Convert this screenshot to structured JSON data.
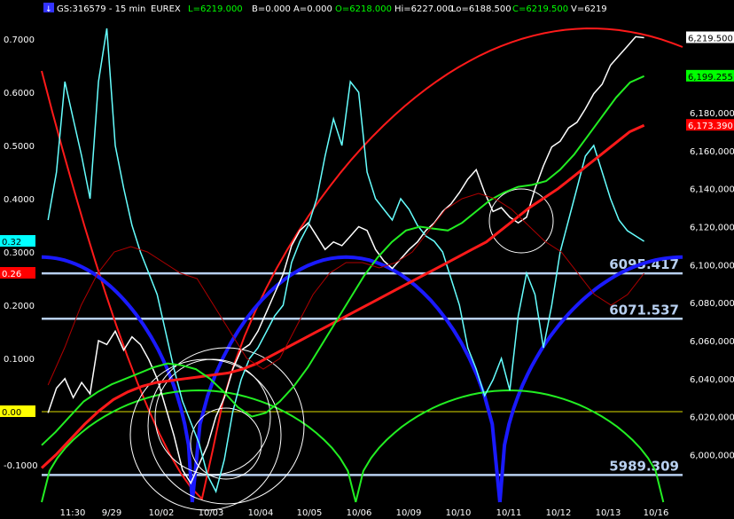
{
  "header": {
    "icon_glyph": "↓",
    "symbol": "GS:316579 - 15 min",
    "exchange": "EUREX",
    "last": "L=6219.000",
    "bid": "B=0.000",
    "ask": "A=0.000",
    "open": "O=6218.000",
    "high": "Hi=6227.000",
    "low": "Lo=6188.500",
    "close": "C=6219.500",
    "volume": "V=6219"
  },
  "colors": {
    "background": "#000000",
    "text": "#ffffff",
    "last_text": "#00ff00",
    "price": "#ffffff",
    "oscillator": "#66ffff",
    "red_line": "#ff1a1a",
    "green_line": "#22ee22",
    "dark_red_line": "#b00000",
    "blue_arcs": "#1a1aff",
    "level_lines": "#b8d0f0",
    "zero_line": "#dddd00",
    "axis_text": "#ffffff"
  },
  "chart_data": {
    "type": "line",
    "left_axis": {
      "ticks": [
        "0.7000",
        "0.6000",
        "0.5000",
        "0.4000",
        "0.3000",
        "0.2000",
        "0.1000",
        "0.00",
        "-0.1000"
      ],
      "ylim": [
        -0.17,
        0.74
      ]
    },
    "right_axis": {
      "ticks": [
        "6,220,000",
        "6,180,000",
        "6,160,000",
        "6,140,000",
        "6,120,000",
        "6,100,000",
        "6,080,000",
        "6,060,000",
        "6,040,000",
        "6,020,000",
        "6,000,000"
      ],
      "ylim": [
        5975,
        6230
      ]
    },
    "x_ticks": [
      "11:30",
      "9/29",
      "10/02",
      "10/03",
      "10/04",
      "10/05",
      "10/06",
      "10/09",
      "10/10",
      "10/11",
      "10/12",
      "10/13",
      "10/16"
    ],
    "markers": [
      {
        "label": "0.32",
        "axis": "left",
        "value": 0.32,
        "bg": "#00ffff",
        "fg": "#000000"
      },
      {
        "label": "0.26",
        "axis": "left",
        "value": 0.26,
        "bg": "#ff0000",
        "fg": "#ffffff"
      },
      {
        "label": "0.00",
        "axis": "left",
        "value": 0.0,
        "bg": "#ffff00",
        "fg": "#000000"
      },
      {
        "label": "6,219.500",
        "axis": "right",
        "value": 6219.5,
        "bg": "#ffffff",
        "fg": "#000000"
      },
      {
        "label": "6,199.255",
        "axis": "right",
        "value": 6199.255,
        "bg": "#00ff00",
        "fg": "#000000"
      },
      {
        "label": "6,173.390",
        "axis": "right",
        "value": 6173.39,
        "bg": "#ff0000",
        "fg": "#ffffff"
      }
    ],
    "levels": [
      {
        "label": "6095.417",
        "value": 6095.417
      },
      {
        "label": "6071.537",
        "value": 6071.537
      },
      {
        "label": "5989.309",
        "value": 5989.309
      }
    ],
    "zero_line": 0.0,
    "series": [
      {
        "name": "",
        "role": "price",
        "color": "#ffffff",
        "axis": "right",
        "values": [
          6022,
          6035,
          6040,
          6030,
          6038,
          6032,
          6060,
          6058,
          6065,
          6055,
          6062,
          6058,
          6050,
          6040,
          6025,
          6010,
          5992,
          5985,
          5995,
          6005,
          6020,
          6030,
          6045,
          6055,
          6058,
          6065,
          6075,
          6085,
          6095,
          6110,
          6118,
          6122,
          6115,
          6108,
          6112,
          6110,
          6115,
          6120,
          6118,
          6108,
          6102,
          6098,
          6103,
          6108,
          6112,
          6118,
          6122,
          6128,
          6132,
          6138,
          6145,
          6150,
          6138,
          6128,
          6130,
          6125,
          6122,
          6125,
          6140,
          6152,
          6162,
          6165,
          6172,
          6175,
          6182,
          6190,
          6195,
          6205,
          6210,
          6215,
          6220,
          6219.5
        ]
      },
      {
        "name": "",
        "role": "oscillator",
        "color": "#66ffff",
        "axis": "left",
        "values": [
          0.36,
          0.45,
          0.62,
          0.55,
          0.48,
          0.4,
          0.62,
          0.72,
          0.5,
          0.42,
          0.35,
          0.3,
          0.26,
          0.22,
          0.15,
          0.08,
          0.02,
          -0.02,
          -0.06,
          -0.12,
          -0.15,
          -0.09,
          0.0,
          0.06,
          0.1,
          0.12,
          0.15,
          0.18,
          0.2,
          0.28,
          0.32,
          0.35,
          0.4,
          0.48,
          0.55,
          0.5,
          0.62,
          0.6,
          0.45,
          0.4,
          0.38,
          0.36,
          0.4,
          0.38,
          0.35,
          0.33,
          0.32,
          0.3,
          0.25,
          0.2,
          0.12,
          0.08,
          0.03,
          0.06,
          0.1,
          0.04,
          0.18,
          0.26,
          0.22,
          0.12,
          0.2,
          0.3,
          0.36,
          0.42,
          0.48,
          0.5,
          0.45,
          0.4,
          0.36,
          0.34,
          0.33,
          0.32
        ]
      },
      {
        "name": "",
        "role": "avg_slow",
        "color": "#ff1a1a",
        "axis": "right",
        "values": [
          5993,
          6000,
          6008,
          6016,
          6023,
          6029,
          6033,
          6036,
          6038,
          6039,
          6040,
          6041,
          6042,
          6043,
          6045,
          6048,
          6052,
          6056,
          6060,
          6064,
          6068,
          6072,
          6076,
          6080,
          6084,
          6088,
          6092,
          6096,
          6100,
          6104,
          6108,
          6112,
          6118,
          6124,
          6130,
          6135,
          6140,
          6146,
          6152,
          6158,
          6164,
          6170,
          6173.39
        ]
      },
      {
        "name": "",
        "role": "avg_fast",
        "color": "#22ee22",
        "axis": "right",
        "values": [
          6005,
          6012,
          6020,
          6028,
          6033,
          6037,
          6040,
          6043,
          6046,
          6048,
          6047,
          6045,
          6040,
          6033,
          6025,
          6020,
          6022,
          6028,
          6036,
          6046,
          6058,
          6070,
          6082,
          6094,
          6104,
          6112,
          6118,
          6120,
          6119,
          6118,
          6122,
          6128,
          6134,
          6138,
          6141,
          6142,
          6144,
          6150,
          6158,
          6168,
          6178,
          6188,
          6196,
          6199.255
        ]
      },
      {
        "name": "",
        "role": "avg_thin",
        "color": "#b00000",
        "axis": "left",
        "values": [
          0.05,
          0.12,
          0.2,
          0.26,
          0.3,
          0.31,
          0.3,
          0.28,
          0.26,
          0.25,
          0.2,
          0.15,
          0.1,
          0.08,
          0.1,
          0.16,
          0.22,
          0.26,
          0.28,
          0.28,
          0.27,
          0.28,
          0.3,
          0.34,
          0.38,
          0.4,
          0.41,
          0.4,
          0.38,
          0.35,
          0.32,
          0.3,
          0.26,
          0.22,
          0.2,
          0.22,
          0.26
        ]
      }
    ],
    "cycles": [
      {
        "role": "red_arc",
        "color": "#ff1a1a",
        "x": [
          0.0,
          0.26,
          0.75,
          1.0
        ],
        "peak": 0.72,
        "low": -0.17
      },
      {
        "role": "blue_arcs",
        "color": "#1a1aff",
        "troughs": [
          0.235,
          0.715
        ],
        "peak_value": 6104
      },
      {
        "role": "green_arcs",
        "color": "#22ee22",
        "troughs": [
          0.0,
          0.49,
          0.97
        ],
        "peak_value": 0.04
      }
    ]
  }
}
